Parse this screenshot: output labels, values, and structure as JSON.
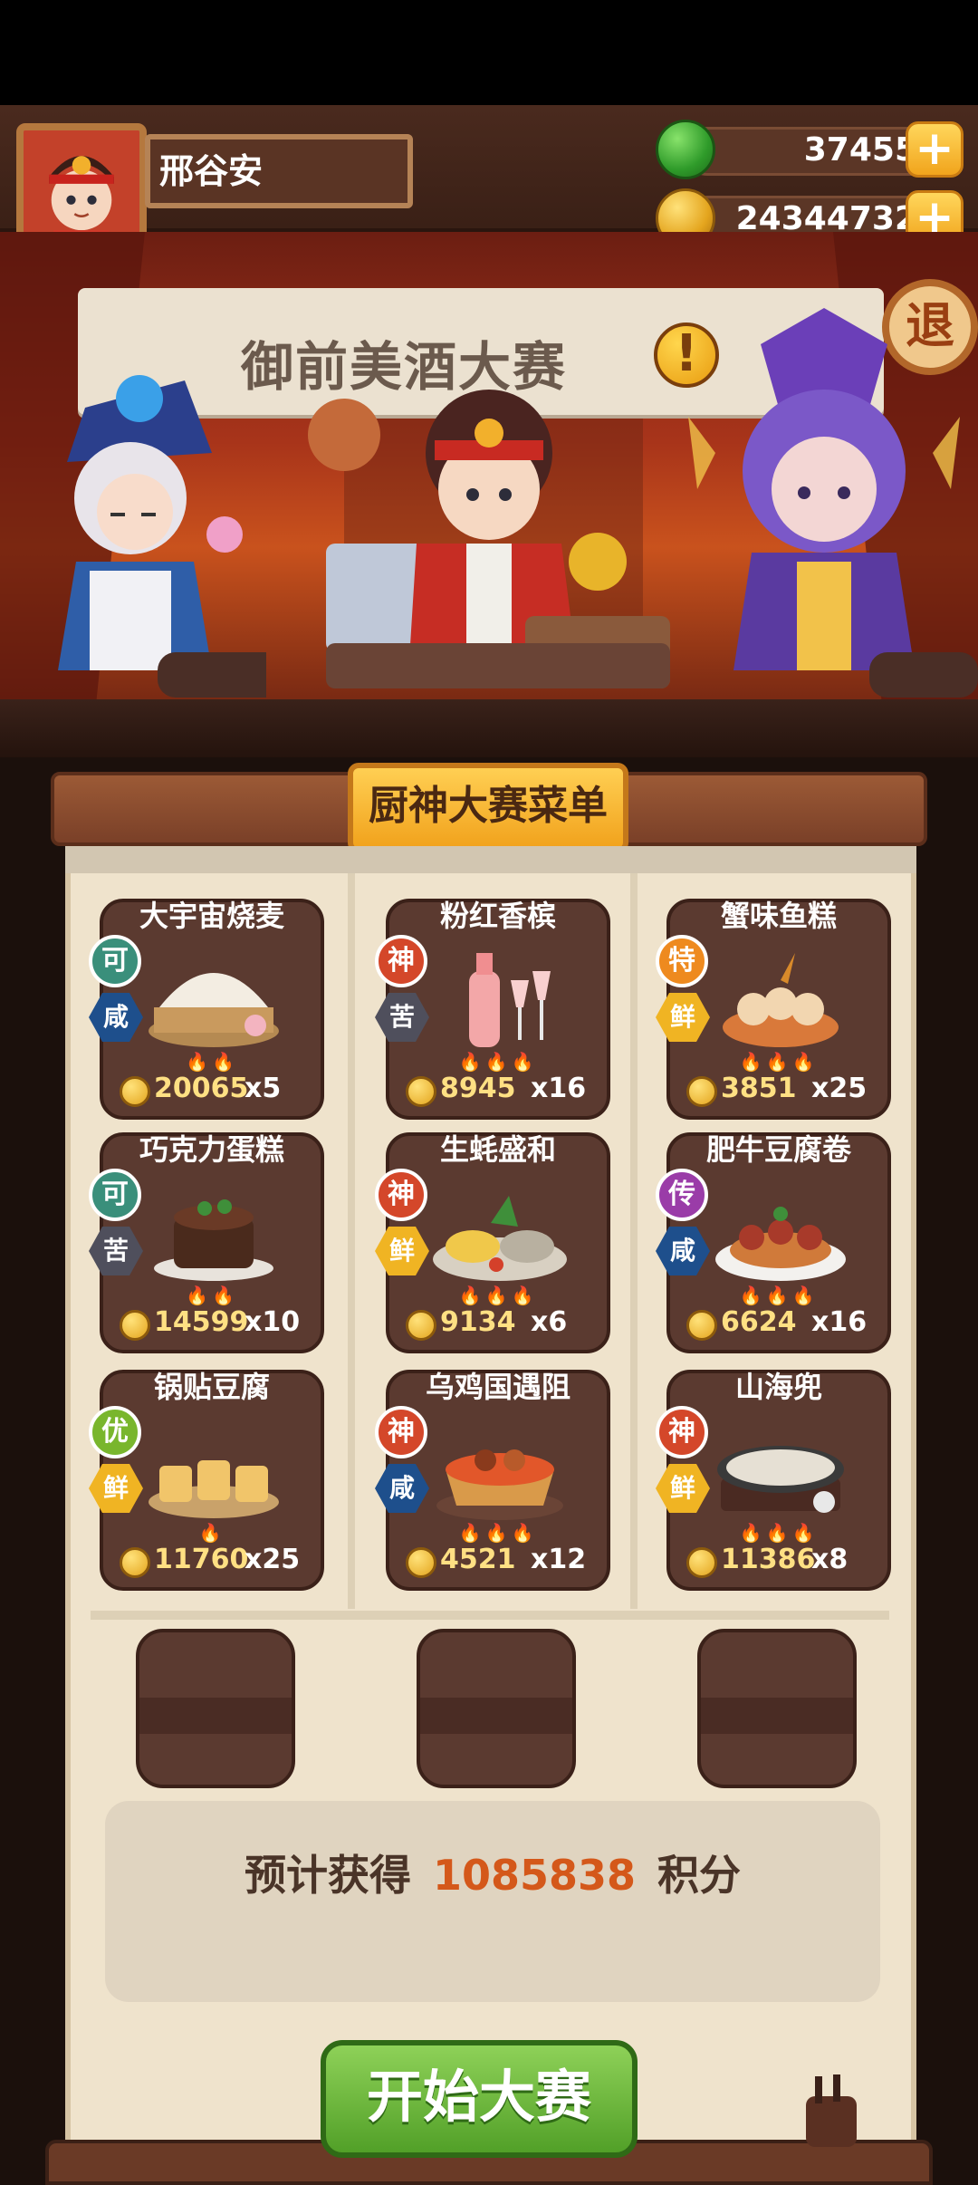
{
  "player": {
    "name": "邢谷安"
  },
  "currency": {
    "jade": "37455",
    "coins": "24344732",
    "add_label": "+"
  },
  "event": {
    "banner_title": "御前美酒大赛",
    "alert_glyph": "!",
    "exit_label": "退"
  },
  "menu": {
    "title": "厨神大赛菜单",
    "dishes": [
      {
        "name": "大宇宙烧麦",
        "grade": "可",
        "taste": "咸",
        "flames": 2,
        "price": "20065",
        "qty": "x5"
      },
      {
        "name": "粉红香槟",
        "grade": "神",
        "taste": "苦",
        "flames": 3,
        "price": "8945",
        "qty": "x16"
      },
      {
        "name": "蟹味鱼糕",
        "grade": "特",
        "taste": "鲜",
        "flames": 3,
        "price": "3851",
        "qty": "x25"
      },
      {
        "name": "巧克力蛋糕",
        "grade": "可",
        "taste": "苦",
        "flames": 2,
        "price": "14599",
        "qty": "x10"
      },
      {
        "name": "生蚝盛和",
        "grade": "神",
        "taste": "鲜",
        "flames": 3,
        "price": "9134",
        "qty": "x6"
      },
      {
        "name": "肥牛豆腐卷",
        "grade": "传",
        "taste": "咸",
        "flames": 3,
        "price": "6624",
        "qty": "x16"
      },
      {
        "name": "锅贴豆腐",
        "grade": "优",
        "taste": "鲜",
        "flames": 1,
        "price": "11760",
        "qty": "x25"
      },
      {
        "name": "乌鸡国遇阻",
        "grade": "神",
        "taste": "咸",
        "flames": 3,
        "price": "4521",
        "qty": "x12"
      },
      {
        "name": "山海兜",
        "grade": "神",
        "taste": "鲜",
        "flames": 3,
        "price": "11386",
        "qty": "x8"
      }
    ]
  },
  "estimate": {
    "prefix": "预计获得",
    "value": "1085838",
    "suffix": "积分"
  },
  "start_button": {
    "label": "开始大赛"
  },
  "colors": {
    "grade_ke": "#3a8f7b",
    "grade_shen": "#d4472a",
    "grade_te": "#ee8a1f",
    "grade_chuan": "#9a3ca8",
    "grade_you": "#79b62d",
    "taste_xian": "#f0b423",
    "taste_ku": "#4f4f5c",
    "taste_xian_salty": "#1e4f8c",
    "accent_green": "#52a028",
    "score_orange": "#d4581a"
  }
}
